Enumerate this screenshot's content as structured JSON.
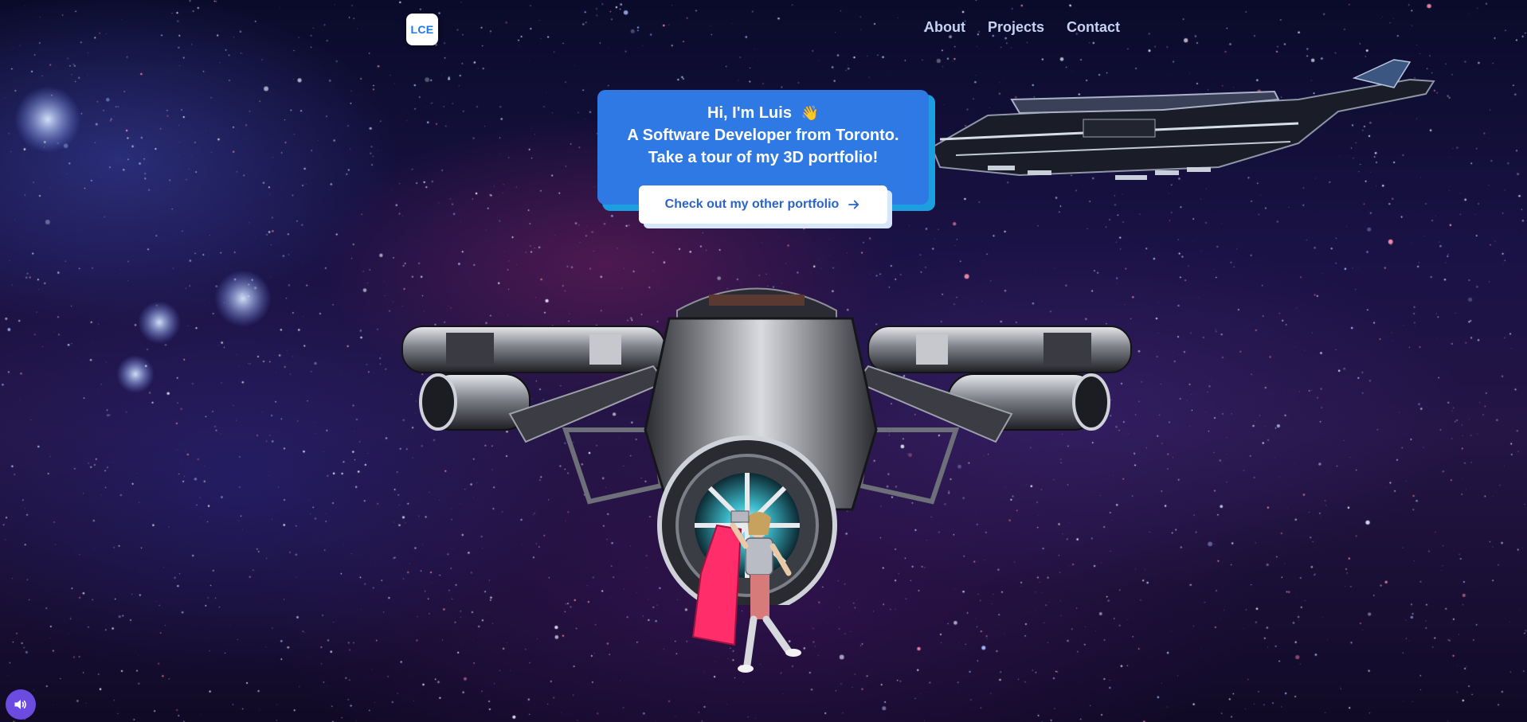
{
  "nav": {
    "logo_text": "LCE",
    "links": [
      "About",
      "Projects",
      "Contact"
    ]
  },
  "hero": {
    "greeting_prefix": "Hi, I'm",
    "name": "Luis",
    "wave_emoji": "👋",
    "line2": "A Software Developer from Toronto.",
    "line3": "Take a tour of my 3D portfolio!",
    "cta_label": "Check out my other portfolio"
  },
  "icons": {
    "cta": "arrow-right-icon",
    "sound": "speaker-icon"
  },
  "colors": {
    "card": "#2f79e5",
    "card_shadow": "#1b9fe0",
    "cta_text": "#2a64c9",
    "logo_text": "#1f7ae0",
    "nav_text": "#c6d3f0",
    "sound_button": "#6b4be0"
  }
}
